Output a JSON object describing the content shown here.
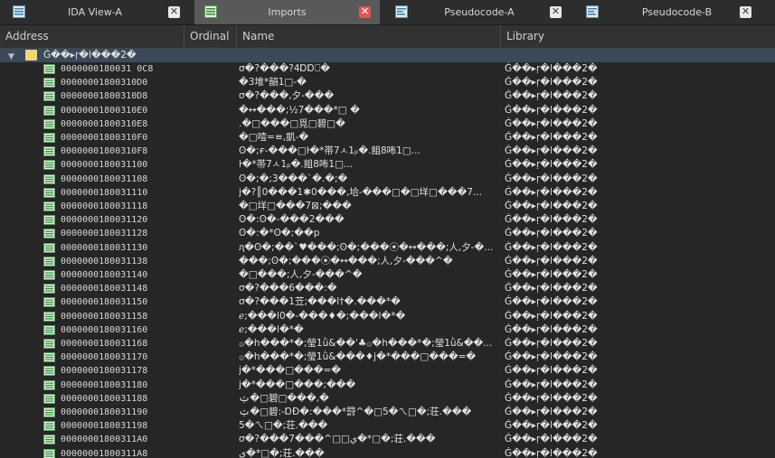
{
  "tabs": [
    {
      "label": "IDA View-A",
      "icon": "listing-icon",
      "active": false
    },
    {
      "label": "Imports",
      "icon": "imports-table-icon",
      "active": true
    },
    {
      "label": "Pseudocode-A",
      "icon": "pseudocode-icon",
      "active": false
    },
    {
      "label": "Pseudocode-B",
      "icon": "pseudocode-icon",
      "active": false
    }
  ],
  "close_glyph": "✕",
  "columns": {
    "address": "Address",
    "ordinal": "Ordinal",
    "name": "Name",
    "library": "Library"
  },
  "group": {
    "label": "Ǵ��▸ṛ�l���2�",
    "expanded_glyph": "▼"
  },
  "rows": [
    {
      "address": "0000000180031 0C8",
      "name": "σ�?���?4ⱰⱰ⎕�",
      "library": "Ǵ��▸ṛ�l���2�"
    },
    {
      "address": "00000001800310D0",
      "name": "̅�3堆*韻1□-�",
      "library": "Ǵ��▸ṛ�l���2�"
    },
    {
      "address": "00000001800310D8",
      "name": "σ�?���,夕-���",
      "library": "Ǵ��▸ṛ�l���2�"
    },
    {
      "address": "00000001800310E0",
      "name": "�↔���;½7���*□        �",
      "library": "Ǵ��▸ṛ�l���2�"
    },
    {
      "address": "00000001800310E8",
      "name": ".�□���□覓□碧□�",
      "library": "Ǵ��▸ṛ�l���2�"
    },
    {
      "address": "00000001800310F0",
      "name": "�□噎=≡,凱-�",
      "library": "Ǵ��▸ṛ�l���2�"
    },
    {
      "address": "00000001800310F8",
      "name": "ʘ�;ғ-���□ŀ�*帯7ㅅ1ₚ�.飷8咘1□...",
      "library": "Ǵ��▸ṛ�l���2�"
    },
    {
      "address": "0000000180031100",
      "name": "ŀ�*帯7ㅅ1ₚ�.飷8咘1□...",
      "library": "Ǵ��▸ṛ�l���2�"
    },
    {
      "address": "0000000180031108",
      "name": "ʘ�;�;3���`�.�;�",
      "library": "Ǵ��▸ṛ�l���2�"
    },
    {
      "address": "0000000180031110",
      "name": "j�?║0���1✱0���,垥-���□�□垟□���7...",
      "library": "Ǵ��▸ṛ�l���2�"
    },
    {
      "address": "0000000180031118",
      "name": "�□垟□���7⊠;���",
      "library": "Ǵ��▸ṛ�l���2�"
    },
    {
      "address": "0000000180031120",
      "name": "ʘ�:ʘ�-���2���",
      "library": "Ǵ��▸ṛ�l���2�"
    },
    {
      "address": "0000000180031128",
      "name": "ʘ�:�*ʘ�;��p",
      "library": "Ǵ��▸ṛ�l���2�"
    },
    {
      "address": "0000000180031130",
      "name": "ԯ�ʘ�;��`♥���;ʘ�;���⦿�↔���;人,夕-�...",
      "library": "Ǵ��▸ṛ�l���2�"
    },
    {
      "address": "0000000180031138",
      "name": "���;ʘ�;���⦿�↔���;人,夕-���^�",
      "library": "Ǵ��▸ṛ�l���2�"
    },
    {
      "address": "0000000180031140",
      "name": "�□���;人,夕-���^�",
      "library": "Ǵ��▸ṛ�l���2�"
    },
    {
      "address": "0000000180031148",
      "name": "σ�?���6���:�",
      "library": "Ǵ��▸ṛ�l���2�"
    },
    {
      "address": "0000000180031150",
      "name": "σ�?���1苙;���l†�.���*�",
      "library": "Ǵ��▸ṛ�l���2�"
    },
    {
      "address": "0000000180031158",
      "name": "ℯ;���l0�-���♦�;���l�*�",
      "library": "Ǵ��▸ṛ�l���2�"
    },
    {
      "address": "0000000180031160",
      "name": "ℯ;���l�*�",
      "library": "Ǵ��▸ṛ�l���2�"
    },
    {
      "address": "0000000180031168",
      "name": "۞�h���*�;瑩1ǜ&��'♣۞�h���*�;瑩1ǜ&��...",
      "library": "Ǵ��▸ṛ�l���2�"
    },
    {
      "address": "0000000180031170",
      "name": "۞�h���*�;瑩1ǜ&���♦j�*���□���=�",
      "library": "Ǵ��▸ṛ�l���2�"
    },
    {
      "address": "0000000180031178",
      "name": "j�*���□���=�",
      "library": "Ǵ��▸ṛ�l���2�"
    },
    {
      "address": "0000000180031180",
      "name": "j�*���□���;���",
      "library": "Ǵ��▸ṛ�l���2�"
    },
    {
      "address": "0000000180031188",
      "name": "ࢶ�□碧□���,�",
      "library": "Ǵ��▸ṛ�l���2�"
    },
    {
      "address": "0000000180031190",
      "name": "ࢶ�□碧:-ⱰĐ�:���*罸^�□5�ㄟ□�;荘.���",
      "library": "Ǵ��▸ṛ�l���2�"
    },
    {
      "address": "0000000180031198",
      "name": "5�ㄟ□�;荘.���",
      "library": "Ǵ��▸ṛ�l���2�"
    },
    {
      "address": "00000001800311A0",
      "name": "σ�?���7���^□□ي�*□�;荘.���",
      "library": "Ǵ��▸ṛ�l���2�"
    },
    {
      "address": "00000001800311A8",
      "name": "ي�*□�;荘.���",
      "library": "Ǵ��▸ṛ�l���2�"
    }
  ]
}
